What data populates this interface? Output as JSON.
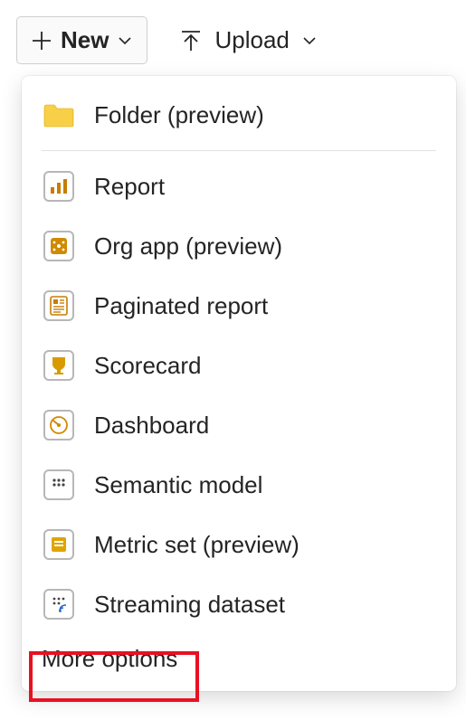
{
  "toolbar": {
    "new_label": "New",
    "upload_label": "Upload"
  },
  "dropdown": {
    "items": [
      {
        "label": "Folder (preview)",
        "icon": "folder-icon"
      },
      {
        "label": "Report",
        "icon": "report-icon"
      },
      {
        "label": "Org app (preview)",
        "icon": "org-app-icon"
      },
      {
        "label": "Paginated report",
        "icon": "paginated-report-icon"
      },
      {
        "label": "Scorecard",
        "icon": "scorecard-icon"
      },
      {
        "label": "Dashboard",
        "icon": "dashboard-icon"
      },
      {
        "label": "Semantic model",
        "icon": "semantic-model-icon"
      },
      {
        "label": "Metric set (preview)",
        "icon": "metric-set-icon"
      },
      {
        "label": "Streaming dataset",
        "icon": "streaming-dataset-icon"
      }
    ],
    "more_options_label": "More options"
  }
}
